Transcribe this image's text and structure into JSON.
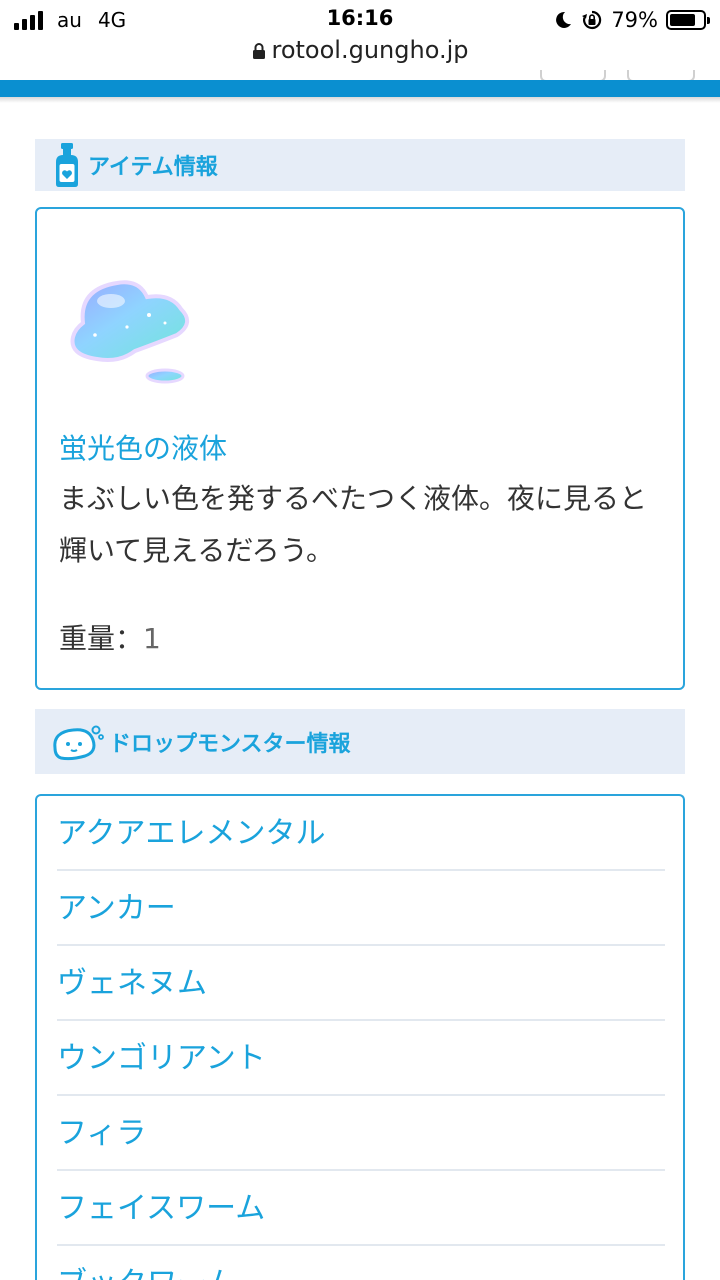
{
  "status_bar": {
    "carrier": "au",
    "network": "4G",
    "time": "16:16",
    "battery_percent": "79%",
    "battery_level": 0.79
  },
  "browser": {
    "url": "rotool.gungho.jp"
  },
  "colors": {
    "accent": "#1aa3dc",
    "header_bar": "#0a8fd0",
    "section_bg": "#e6edf7",
    "border": "#2aa4dc"
  },
  "item_section": {
    "title": "アイテム情報",
    "icon": "potion-bottle-icon",
    "item_icon": "glowing-liquid-icon",
    "name": "蛍光色の液体",
    "description": "まぶしい色を発するべたつく液体。夜に見ると輝いて見えるだろう。",
    "weight_label": "重量：",
    "weight_value": "1"
  },
  "drop_section": {
    "title": "ドロップモンスター情報",
    "icon": "slime-monster-icon",
    "monsters": [
      "アクアエレメンタル",
      "アンカー",
      "ヴェネヌム",
      "ウンゴリアント",
      "フィラ",
      "フェイスワーム",
      "ブックワーム"
    ]
  }
}
